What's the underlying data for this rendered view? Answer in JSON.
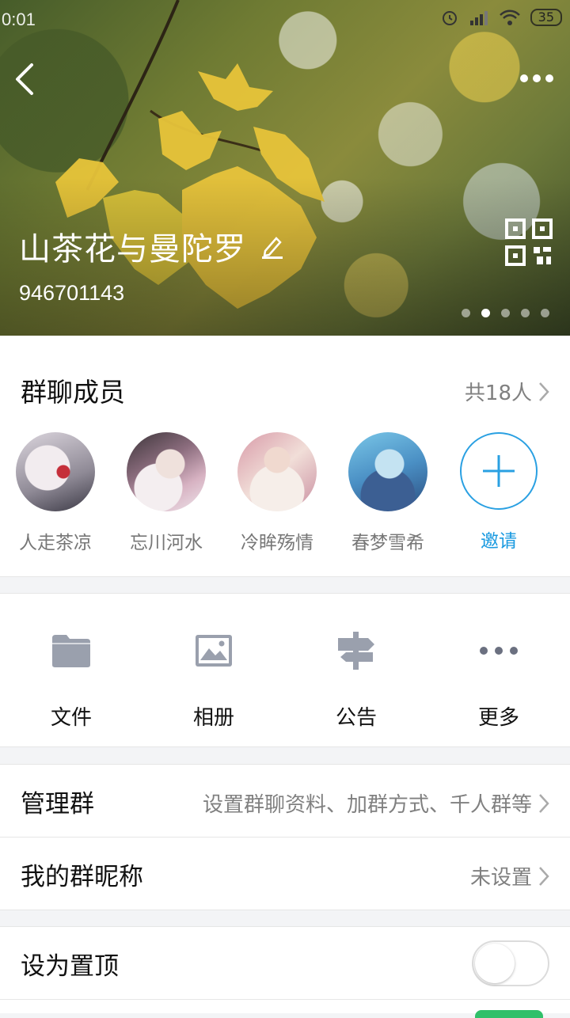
{
  "status_bar": {
    "time": "0:01",
    "battery": "35"
  },
  "header": {
    "group_name": "山茶花与曼陀罗",
    "group_id": "946701143",
    "pager_count": 5,
    "pager_active": 1
  },
  "members": {
    "title": "群聊成员",
    "count_label": "共18人",
    "list": [
      {
        "name": "人走茶凉"
      },
      {
        "name": "忘川河水"
      },
      {
        "name": "冷眸殇情"
      },
      {
        "name": "春梦雪希"
      }
    ],
    "invite_label": "邀请"
  },
  "tools": [
    {
      "label": "文件",
      "icon": "folder-icon"
    },
    {
      "label": "相册",
      "icon": "image-icon"
    },
    {
      "label": "公告",
      "icon": "signpost-icon"
    },
    {
      "label": "更多",
      "icon": "more-icon"
    }
  ],
  "settings": {
    "manage": {
      "label": "管理群",
      "value": "设置群聊资料、加群方式、千人群等"
    },
    "nickname": {
      "label": "我的群昵称",
      "value": "未设置"
    },
    "pin": {
      "label": "设为置顶",
      "on": false
    }
  },
  "colors": {
    "accent": "#1a9ae0",
    "icon_gray": "#9aa0ad",
    "toggle_on": "#31c06a"
  }
}
